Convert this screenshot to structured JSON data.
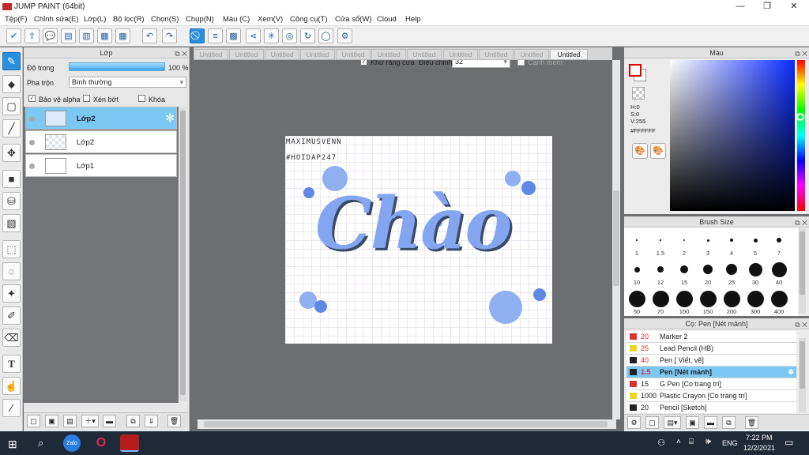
{
  "window": {
    "title": "JUMP PAINT (64bit)"
  },
  "menu": [
    "Tệp(F)",
    "Chỉnh sửa(E)",
    "Lớp(L)",
    "Bộ lọc(R)",
    "Chọn(S)",
    "Chụp(N)",
    "Màu (C)",
    "Xem(V)",
    "Công cụ(T)",
    "Cửa sổ(W)",
    "Cloud",
    "Help"
  ],
  "toolbar": {
    "antialias_label": "Khử răng cưa",
    "adjust_label": "Điều chỉnh",
    "adjust_value": "32",
    "smooth_label": "Cạnh mềm"
  },
  "layer_panel": {
    "title": "Lớp",
    "opacity_label": "Độ trong",
    "opacity_value": "100 %",
    "blend_label": "Pha trộn",
    "blend_value": "Bình thường",
    "protect_alpha": "Bảo vệ alpha",
    "clip": "Xén bớt",
    "lock": "Khóa",
    "layers": [
      {
        "name": "Lớp2"
      },
      {
        "name": "Lớp2"
      },
      {
        "name": "Lớp1"
      }
    ]
  },
  "tabs": [
    "Untitled",
    "Untitled",
    "Untitled",
    "Untitled",
    "Untitled",
    "Untitled",
    "Untitled",
    "Untitled",
    "Untitled",
    "Untitled",
    "Untitled"
  ],
  "canvas": {
    "watermark_line1": "MAXIMUSVENN",
    "watermark_line2": "#HOIDAP247",
    "lettering": "Chào"
  },
  "color_panel": {
    "title": "Màu",
    "h": "H:0",
    "s": "S:0",
    "v": "V:255",
    "hex": "#FFFFFF",
    "accent": "#ff0000"
  },
  "brush_panel": {
    "title": "Brush Size",
    "sizes": [
      "1",
      "1.5",
      "2",
      "3",
      "4",
      "5",
      "7",
      "10",
      "12",
      "15",
      "20",
      "25",
      "30",
      "40",
      "50",
      "70",
      "100",
      "150",
      "200",
      "300",
      "400"
    ]
  },
  "pen_panel": {
    "title": "Cọ: Pen [Nét mảnh]",
    "items": [
      {
        "size": "20",
        "name": "Marker 2",
        "color": "#e03030"
      },
      {
        "size": "25",
        "name": "Lead Pencil (HB)",
        "color": "#e8d820"
      },
      {
        "size": "40",
        "name": "Pen [ Viết, vẽ]",
        "color": "#222222"
      },
      {
        "size": "1.5",
        "name": "Pen [Nét mảnh]",
        "color": "#222222"
      },
      {
        "size": "15",
        "name": "G Pen [Co trang trí]",
        "color": "#e03030"
      },
      {
        "size": "1000",
        "name": "Plastic Crayon [Co trang trí]",
        "color": "#e8d820"
      },
      {
        "size": "20",
        "name": "Pencil [Sketch]",
        "color": "#222222"
      }
    ]
  },
  "taskbar": {
    "time": "7:22 PM",
    "date": "12/2/2021",
    "lang": "ENG",
    "zalo": "Zalo"
  }
}
